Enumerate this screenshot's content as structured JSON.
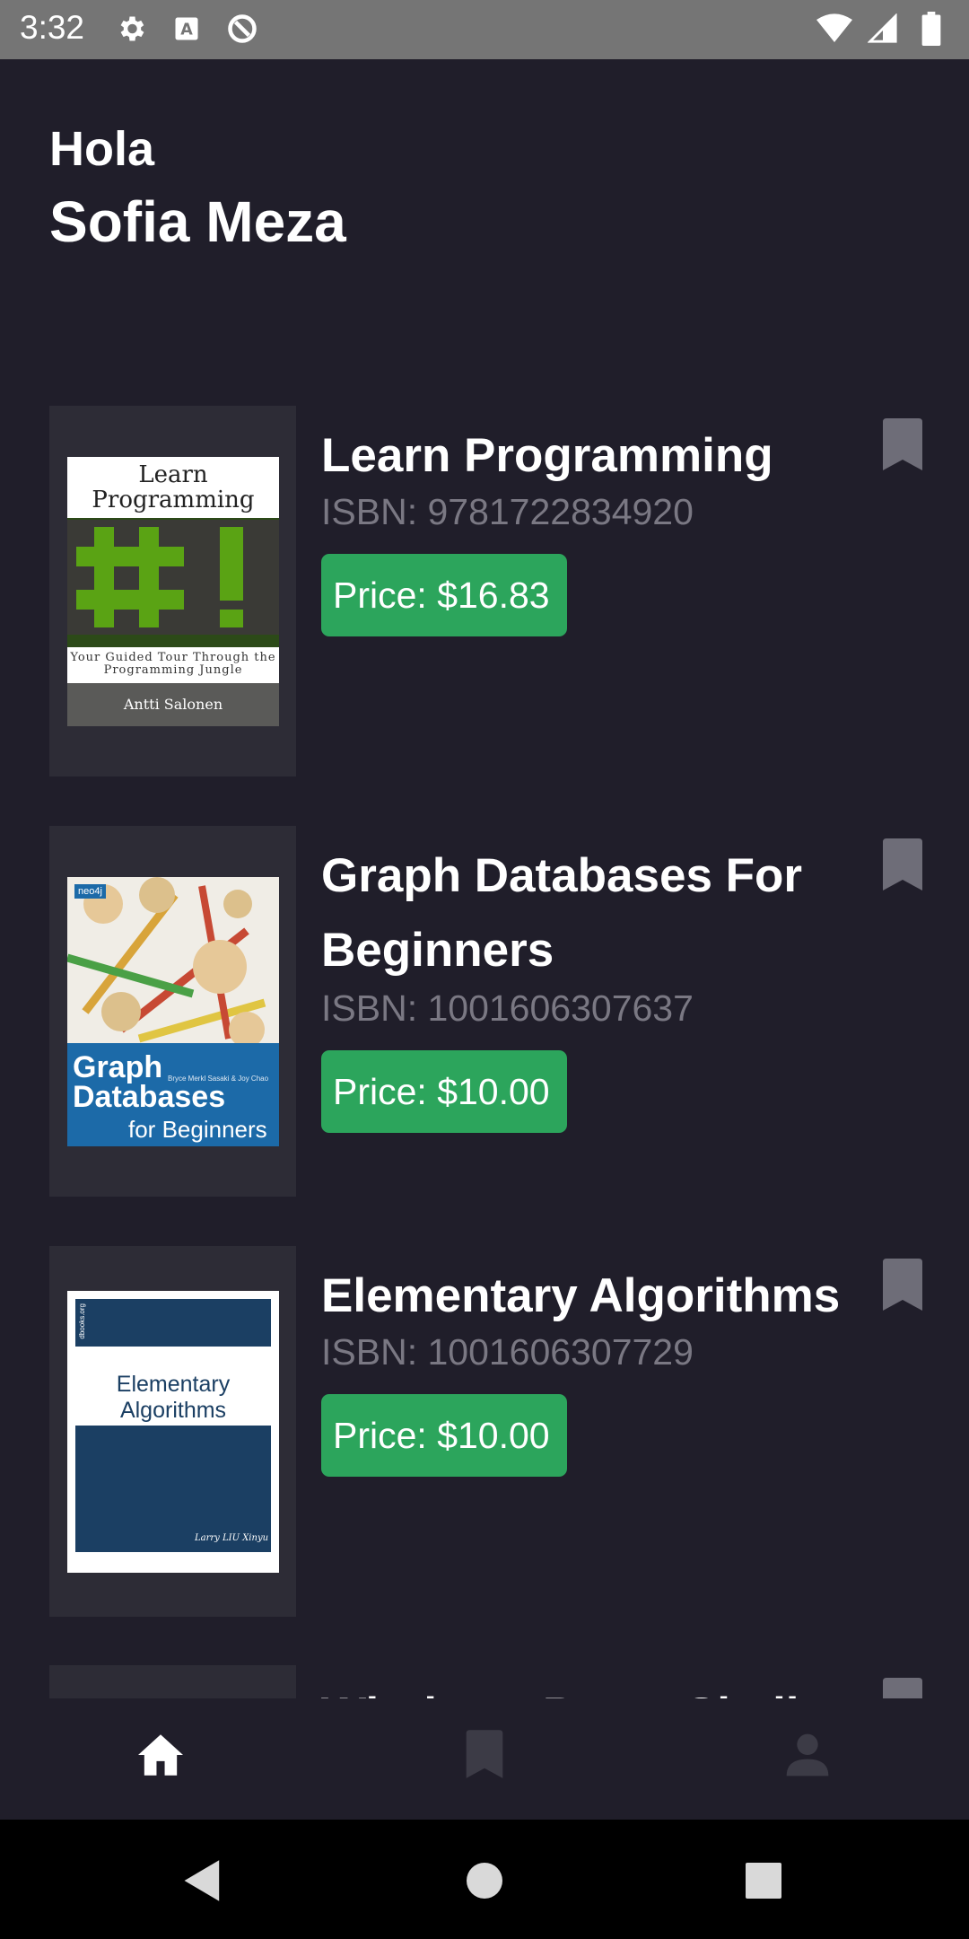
{
  "status_bar": {
    "time": "3:32",
    "icons_left": [
      "gear-icon",
      "font-a-icon",
      "data-saver-icon"
    ],
    "icons_right": [
      "wifi-icon",
      "signal-icon",
      "battery-icon"
    ]
  },
  "greeting": {
    "hello": "Hola",
    "name": "Sofia Meza"
  },
  "books": [
    {
      "title": "Learn Programming",
      "isbn": "ISBN: 9781722834920",
      "price": "Price: $16.83",
      "cover": {
        "title": "Learn Programming",
        "subtitle": "Your Guided Tour Through the Programming Jungle",
        "author": "Antti Salonen",
        "glyph": "#!"
      }
    },
    {
      "title": "Graph Databases For Beginners",
      "isbn": "ISBN: 1001606307637",
      "price": "Price: $10.00",
      "cover": {
        "brand": "neo4j",
        "authors": "Bryce Merkl Sasaki & Joy Chao",
        "title": "Graph Databases",
        "subtitle": "for Beginners"
      }
    },
    {
      "title": "Elementary Algorithms",
      "isbn": "ISBN: 1001606307729",
      "price": "Price: $10.00",
      "cover": {
        "side": "dbooks.org",
        "title": "Elementary Algorithms",
        "author": "Larry LIU Xinyu"
      }
    },
    {
      "title": "Windows PowerShell",
      "isbn": "",
      "price": ""
    }
  ],
  "bottom_nav": {
    "items": [
      {
        "icon": "home-icon",
        "active": true
      },
      {
        "icon": "bookmark-icon",
        "active": false
      },
      {
        "icon": "person-icon",
        "active": false
      }
    ],
    "active_color": "#ffffff",
    "inactive_color": "#3c3b46"
  },
  "system_nav": [
    "back-icon",
    "home-circle-icon",
    "recents-icon"
  ],
  "colors": {
    "background": "#201e2a",
    "card": "#2d2c36",
    "accent": "#2ca55c",
    "muted_text": "#7a7883",
    "bookmark": "#6e6d78"
  }
}
